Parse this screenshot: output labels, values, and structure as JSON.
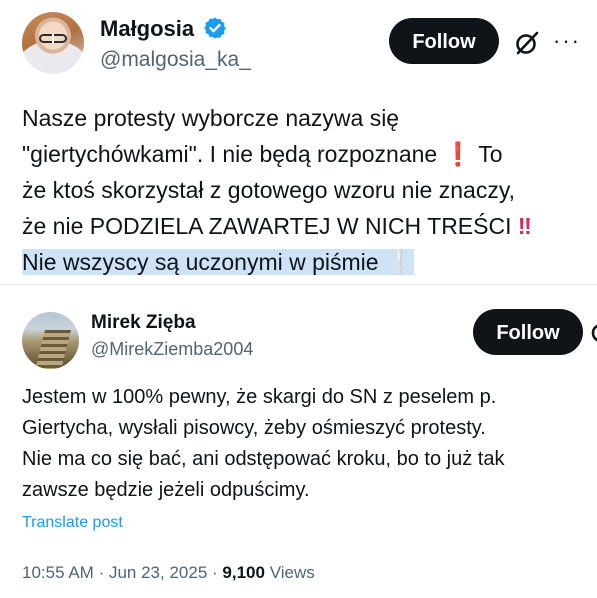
{
  "post1": {
    "author_name": "Małgosia",
    "author_handle": "@malgosia_ka_",
    "follow_label": "Follow",
    "more_label": "···",
    "text_line1": "Nasze protesty wyborcze nazywa się",
    "text_line2_a": "\"giertychówkami\". I nie będą rozpoznane ",
    "text_line2_emoji": "❗",
    "text_line2_b": " To",
    "text_line3": "że ktoś skorzystał z gotowego wzoru nie znaczy,",
    "text_line4_a": "że nie PODZIELA ZAWARTEJ W NICH TREŚCI ",
    "text_line4_emoji": "‼",
    "text_line5_a": "Nie wszyscy są uczonymi w piśmie ",
    "text_line5_emoji": "❕",
    "icons": [
      "verified-badge-icon",
      "grok-icon",
      "more-icon"
    ],
    "colors": {
      "verified": "#1d9bf0",
      "highlight": "#cfe3f7",
      "emoji": "#e0245e"
    }
  },
  "post2": {
    "author_name": "Mirek Zięba",
    "author_handle": "@MirekZiemba2004",
    "follow_label": "Follow",
    "text": "Jestem w 100% pewny, że skargi do SN z peselem p.\nGiertycha, wysłali pisowcy, żeby ośmieszyć protesty.\nNie ma co się bać, ani odstępować kroku, bo to już tak\nzawsze będzie jeżeli odpuścimy.",
    "translate_label": "Translate post",
    "time": "10:55 AM",
    "date": "Jun 23, 2025",
    "separator": "·",
    "views_count": "9,100",
    "views_label": "Views"
  }
}
